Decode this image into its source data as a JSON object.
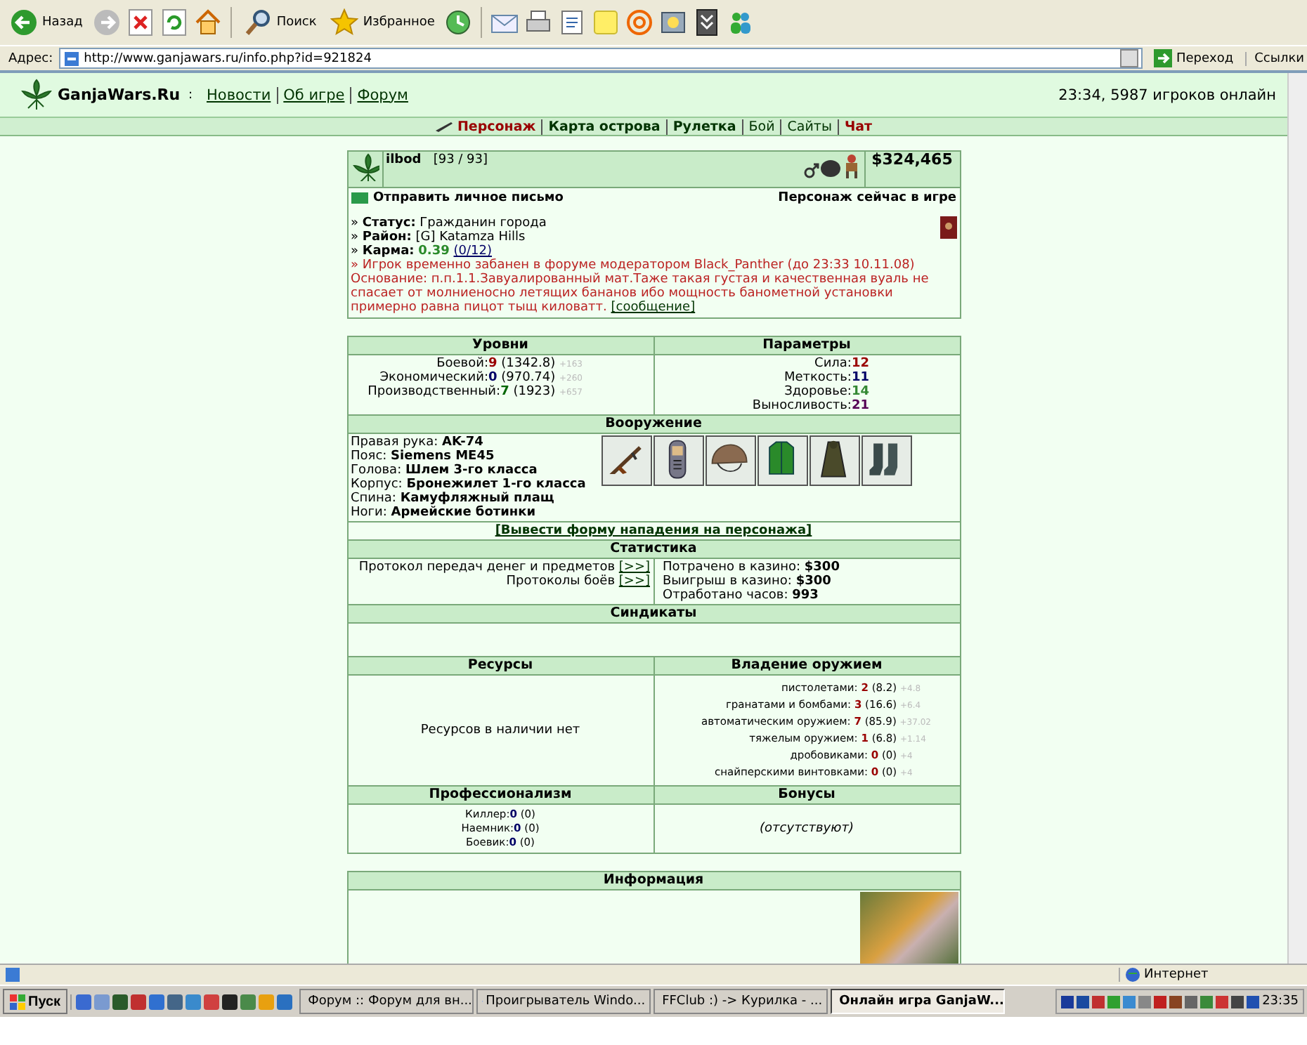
{
  "browser": {
    "toolbar": [
      {
        "kind": "back",
        "label": "Назад"
      },
      {
        "kind": "forward"
      },
      {
        "kind": "stop"
      },
      {
        "kind": "refresh"
      },
      {
        "kind": "home"
      },
      {
        "kind": "search",
        "label": "Поиск"
      },
      {
        "kind": "favorites",
        "label": "Избранное"
      },
      {
        "kind": "history"
      },
      {
        "kind": "mail"
      },
      {
        "kind": "print"
      },
      {
        "kind": "edit"
      },
      {
        "kind": "note"
      },
      {
        "kind": "at"
      },
      {
        "kind": "folder"
      },
      {
        "kind": "archive"
      },
      {
        "kind": "messenger"
      }
    ],
    "address": {
      "label": "Адрес:",
      "value": "http://www.ganjawars.ru/info.php?id=921824",
      "go": "Переход",
      "links": "Ссылки"
    }
  },
  "site": {
    "logo": "GanjaWars.Ru",
    "logo_suffix": ":",
    "links": [
      "Новости",
      "Об игре",
      "Форум"
    ],
    "status": "23:34, 5987 игроков онлайн"
  },
  "menu": [
    {
      "label": "Персонаж",
      "kind": "alert",
      "selected": true
    },
    {
      "label": "Карта острова",
      "kind": "main",
      "selected": false
    },
    {
      "label": "Рулетка",
      "kind": "main",
      "selected": false
    },
    {
      "label": "Бой",
      "kind": "plain",
      "selected": false
    },
    {
      "label": "Сайты",
      "kind": "plain",
      "selected": false
    },
    {
      "label": "Чат",
      "kind": "alert",
      "selected": false
    }
  ],
  "profile": {
    "name": "ilbod",
    "hp": "[93 / 93]",
    "money": "$324,465",
    "message_link": "Отправить личное письмо",
    "presence": "Персонаж сейчас в игре",
    "facts": [
      "» **Статус:** Гражданин города",
      "» **Район:** [G] Katamza Hills"
    ],
    "karma": {
      "label": "» **Карма:**",
      "value": "0.39",
      "votes": "(0/12)"
    },
    "ban": "» Игрок временно забанен в форуме модератором Black_Panther (до 23:33 10.11.08)",
    "reason": "Основание: п.п.1.1.Завуалированный мат.Таже такая густая и качественная вуаль не спасает от молниеносно летящих бананов ибо мощность банометной установки примерно равна пицот тыщ киловатт.",
    "reason_link": "[сообщение]"
  },
  "levels": {
    "title": "Уровни",
    "items": [
      {
        "label": "Боевой:",
        "value": "9",
        "score": "(1342.8)",
        "gain": "+163",
        "color": "#990000"
      },
      {
        "label": "Экономический:",
        "value": "0",
        "score": "(970.74)",
        "gain": "+260",
        "color": "#000066"
      },
      {
        "label": "Производственный:",
        "value": "7",
        "score": "(1923)",
        "gain": "+657",
        "color": "#006600"
      }
    ]
  },
  "params": {
    "title": "Параметры",
    "items": [
      {
        "label": "Сила:",
        "value": "12",
        "color": "#990000"
      },
      {
        "label": "Меткость:",
        "value": "11",
        "color": "#000066"
      },
      {
        "label": "Здоровье:",
        "value": "14",
        "color": "#338833"
      },
      {
        "label": "Выносливость:",
        "value": "21",
        "color": "#550055"
      }
    ]
  },
  "equipment": {
    "title": "Вооружение",
    "slots": [
      {
        "label": "Правая рука:",
        "value": "AK-74",
        "kind": "rifle"
      },
      {
        "label": "Пояс:",
        "value": "Siemens ME45",
        "kind": "phone"
      },
      {
        "label": "Голова:",
        "value": "Шлем 3-го класса",
        "kind": "helmet"
      },
      {
        "label": "Корпус:",
        "value": "Бронежилет 1-го класса",
        "kind": "vest"
      },
      {
        "label": "Спина:",
        "value": "Камуфляжный плащ",
        "kind": "cloak"
      },
      {
        "label": "Ноги:",
        "value": "Армейские ботинки",
        "kind": "boots"
      }
    ]
  },
  "attack_link": "[Вывести форму нападения на персонажа]",
  "statistics": {
    "title": "Статистика",
    "protocols": [
      {
        "label": "Протокол передач денег и предметов",
        "link": "[>>]"
      },
      {
        "label": "Протоколы боёв",
        "link": "[>>]"
      }
    ],
    "casino": [
      {
        "label": "Потрачено в казино:",
        "value": "$300"
      },
      {
        "label": "Выигрыш в казино:",
        "value": "$300"
      },
      {
        "label": "Отработано часов:",
        "value": "993"
      }
    ]
  },
  "syndicates": {
    "title": "Синдикаты"
  },
  "resources": {
    "title": "Ресурсы",
    "text": "Ресурсов в наличии нет"
  },
  "weapons": {
    "title": "Владение оружием",
    "items": [
      {
        "label": "пистолетами:",
        "value": "2",
        "score": "(8.2)",
        "gain": "+4.8"
      },
      {
        "label": "гранатами и бомбами:",
        "value": "3",
        "score": "(16.6)",
        "gain": "+6.4"
      },
      {
        "label": "автоматическим оружием:",
        "value": "7",
        "score": "(85.9)",
        "gain": "+37.02"
      },
      {
        "label": "тяжелым оружием:",
        "value": "1",
        "score": "(6.8)",
        "gain": "+1.14"
      },
      {
        "label": "дробовиками:",
        "value": "0",
        "score": "(0)",
        "gain": "+4"
      },
      {
        "label": "снайперскими винтовками:",
        "value": "0",
        "score": "(0)",
        "gain": "+4"
      }
    ]
  },
  "professionalism": {
    "title": "Профессионализм",
    "items": [
      {
        "label": "Киллер:",
        "value": "0",
        "score": "(0)"
      },
      {
        "label": "Наемник:",
        "value": "0",
        "score": "(0)"
      },
      {
        "label": "Боевик:",
        "value": "0",
        "score": "(0)"
      }
    ]
  },
  "bonuses": {
    "title": "Бонусы",
    "text": "(отсутствуют)"
  },
  "info": {
    "title": "Информация"
  },
  "status_bar": {
    "zone": "Интернет"
  },
  "taskbar": {
    "start": "Пуск",
    "tasks": [
      {
        "label": "Форум :: Форум для вн...",
        "selected": false
      },
      {
        "label": "Проигрыватель Windo...",
        "selected": false
      },
      {
        "label": "FFClub :) -> Курилка - ...",
        "selected": false
      },
      {
        "label": "Онлайн игра GanjaW...",
        "selected": true
      }
    ],
    "clock": "23:35"
  }
}
